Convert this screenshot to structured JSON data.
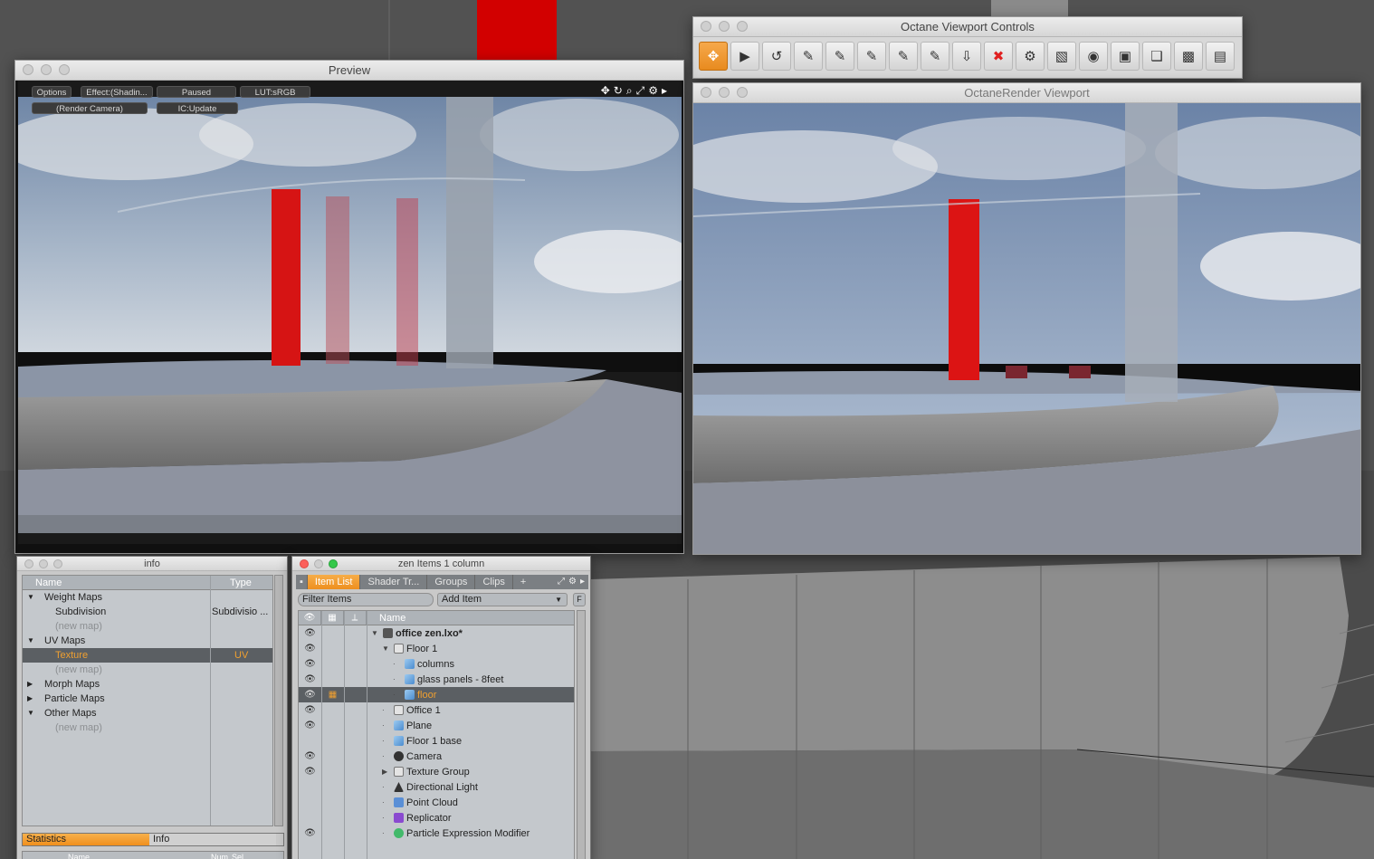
{
  "octane_controls": {
    "title": "Octane Viewport Controls",
    "tools": [
      {
        "icon": "move-icon",
        "active": true
      },
      {
        "icon": "play-icon"
      },
      {
        "icon": "reset-icon"
      },
      {
        "icon": "autofocus-picker-icon"
      },
      {
        "icon": "material-picker-icon"
      },
      {
        "icon": "color-picker-icon"
      },
      {
        "icon": "white-point-picker-icon"
      },
      {
        "icon": "focus-picker-icon"
      },
      {
        "icon": "export-icon"
      },
      {
        "icon": "stop-icon"
      },
      {
        "icon": "object-picker-icon"
      },
      {
        "icon": "region-icon"
      },
      {
        "icon": "camera-icon"
      },
      {
        "icon": "save-image-icon"
      },
      {
        "icon": "layers-icon"
      },
      {
        "icon": "palette-icon"
      },
      {
        "icon": "document-icon"
      }
    ]
  },
  "preview": {
    "title": "Preview",
    "options_label": "Options",
    "effect_label": "Effect:(Shadin...",
    "status_label": "Paused",
    "lut_label": "LUT:sRGB",
    "camera_label": "(Render Camera)",
    "ic_label": "IC:Update"
  },
  "octane_viewport": {
    "title": "OctaneRender Viewport"
  },
  "info_panel": {
    "title": "info",
    "columns": [
      "Name",
      "Type"
    ],
    "rows": [
      {
        "name": "Weight Maps",
        "type": "",
        "level": 0,
        "expanded": true
      },
      {
        "name": "Subdivision",
        "type": "Subdivisio ...",
        "level": 1
      },
      {
        "name": "(new map)",
        "type": "",
        "level": 1,
        "placeholder": true
      },
      {
        "name": "UV Maps",
        "type": "",
        "level": 0,
        "expanded": true
      },
      {
        "name": "Texture",
        "type": "UV",
        "level": 1,
        "selected": true
      },
      {
        "name": "(new map)",
        "type": "",
        "level": 1,
        "placeholder": true
      },
      {
        "name": "Morph Maps",
        "type": "",
        "level": 0,
        "expanded": false
      },
      {
        "name": "Particle Maps",
        "type": "",
        "level": 0,
        "expanded": false
      },
      {
        "name": "Other Maps",
        "type": "",
        "level": 0,
        "expanded": true
      },
      {
        "name": "(new map)",
        "type": "",
        "level": 1,
        "placeholder": true
      }
    ],
    "tabs": [
      "Statistics",
      "Info"
    ],
    "footer_columns": [
      "Name",
      "Num",
      "Sel"
    ]
  },
  "zen_items": {
    "title": "zen Items 1 column",
    "tabs": [
      "Item List",
      "Shader Tr...",
      "Groups",
      "Clips"
    ],
    "add_tab": "+",
    "filter_placeholder": "Filter Items",
    "add_item_label": "Add Item",
    "f_label": "F",
    "name_header": "Name",
    "items": [
      {
        "name": "office zen.lxo*",
        "indent": 0,
        "icon": "scene",
        "eye": true,
        "twist": "▼",
        "bold": true
      },
      {
        "name": "Floor 1",
        "indent": 1,
        "icon": "group",
        "eye": true,
        "twist": "▼"
      },
      {
        "name": "columns",
        "indent": 2,
        "icon": "mesh",
        "eye": true
      },
      {
        "name": "glass panels - 8feet",
        "indent": 2,
        "icon": "mesh",
        "eye": true
      },
      {
        "name": "floor",
        "indent": 2,
        "icon": "mesh",
        "eye": true,
        "selected": true,
        "locked": true
      },
      {
        "name": "Office 1",
        "indent": 1,
        "icon": "group",
        "eye": true
      },
      {
        "name": "Plane",
        "indent": 1,
        "icon": "mesh",
        "eye": true
      },
      {
        "name": "Floor 1 base",
        "indent": 1,
        "icon": "mesh",
        "eye": false
      },
      {
        "name": "Camera",
        "indent": 1,
        "icon": "cam",
        "eye": true
      },
      {
        "name": "Texture Group",
        "indent": 1,
        "icon": "group",
        "eye": true,
        "twist": "▶"
      },
      {
        "name": "Directional Light",
        "indent": 1,
        "icon": "light",
        "eye": false
      },
      {
        "name": "Point Cloud",
        "indent": 1,
        "icon": "pc",
        "eye": false
      },
      {
        "name": "Replicator",
        "indent": 1,
        "icon": "rep",
        "eye": false
      },
      {
        "name": "Particle Expression Modifier",
        "indent": 1,
        "icon": "mod",
        "eye": true
      }
    ]
  },
  "colors": {
    "accent": "#f0962a",
    "selected_text": "#f0a030",
    "column_red": "#e01010"
  }
}
